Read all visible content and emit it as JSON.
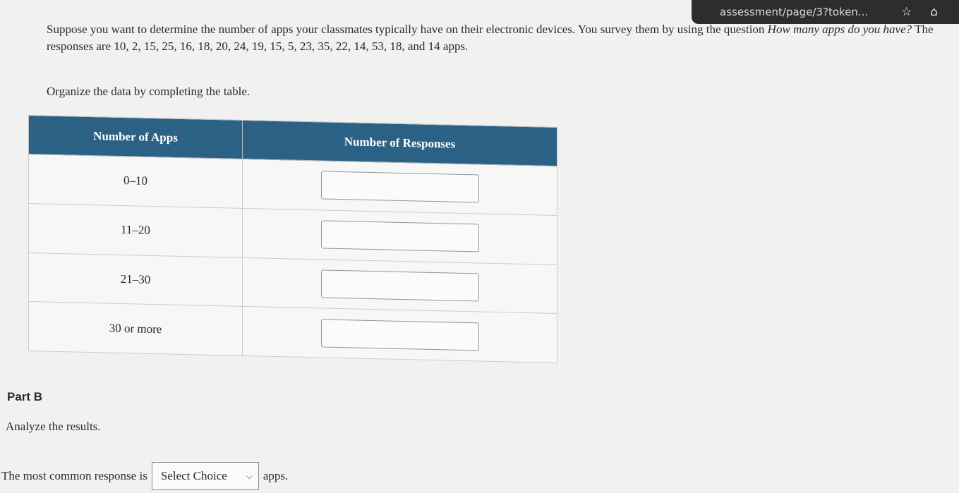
{
  "browser": {
    "url_fragment": "assessment/page/3?token...",
    "icons": [
      "star-icon",
      "extension-icon"
    ]
  },
  "question": {
    "prompt_start": "Suppose you want to determine the number of apps your classmates typically have on their electronic devices. You survey them by using the question ",
    "prompt_question": "How many apps do you have?",
    "prompt_end": " The responses are 10, 2, 15, 25, 16, 18, 20, 24, 19, 15, 5, 23, 35, 22, 14, 53, 18, and 14 apps.",
    "instruction": "Organize the data by completing the table."
  },
  "table": {
    "headers": [
      "Number of Apps",
      "Number of Responses"
    ],
    "rows": [
      {
        "range": "0–10",
        "value": ""
      },
      {
        "range": "11–20",
        "value": ""
      },
      {
        "range": "21–30",
        "value": ""
      },
      {
        "range": "30 or more",
        "value": ""
      }
    ]
  },
  "part_b": {
    "title": "Part B",
    "instruction": "Analyze the results.",
    "sentence_start": "The most common response is",
    "select_value": "Select Choice",
    "sentence_end": "apps."
  }
}
